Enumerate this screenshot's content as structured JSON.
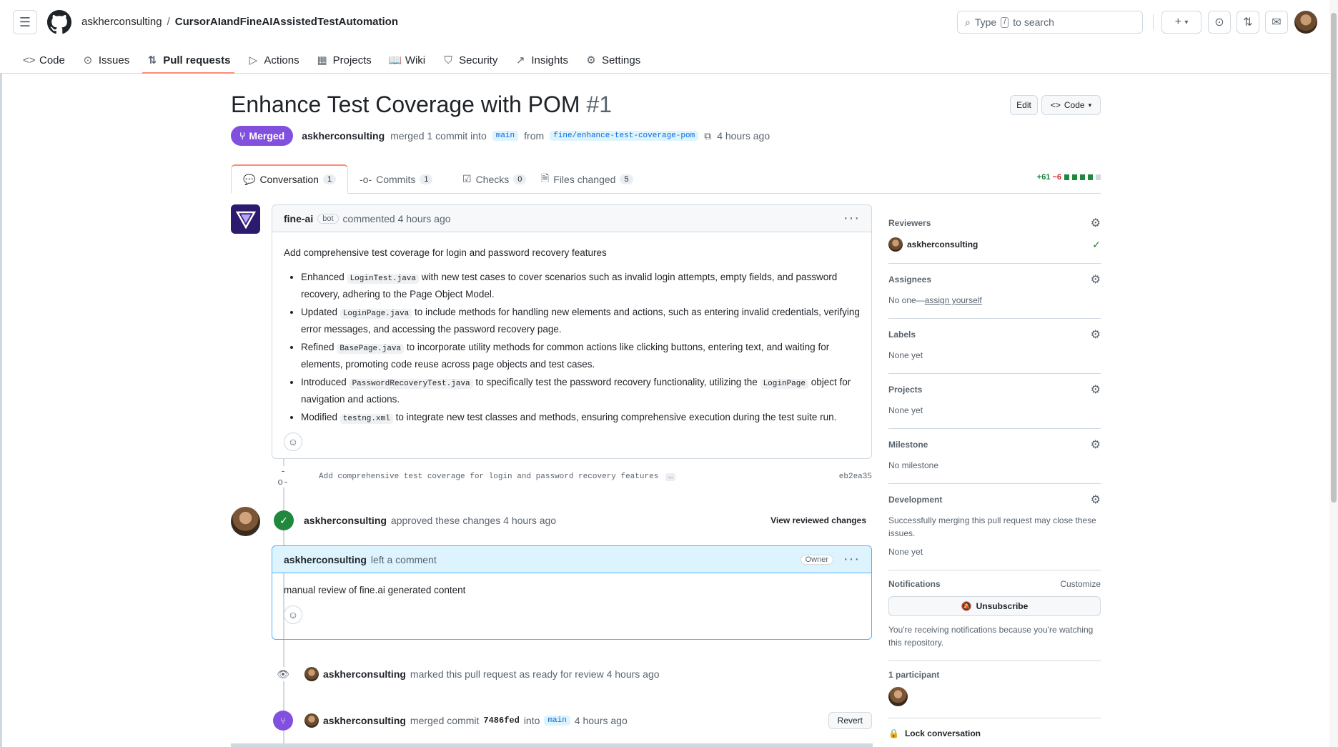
{
  "header": {
    "owner": "askherconsulting",
    "repo": "CursorAIandFineAIAssistedTestAutomation",
    "search_prefix": "Type",
    "search_key": "/",
    "search_suffix": "to search"
  },
  "nav": {
    "code": "Code",
    "issues": "Issues",
    "pull_requests": "Pull requests",
    "actions": "Actions",
    "projects": "Projects",
    "wiki": "Wiki",
    "security": "Security",
    "insights": "Insights",
    "settings": "Settings"
  },
  "pr": {
    "title": "Enhance Test Coverage with POM",
    "number": "#1",
    "edit_label": "Edit",
    "code_label": "Code",
    "state": "Merged",
    "author": "askherconsulting",
    "merged_text": "merged 1 commit into",
    "base_branch": "main",
    "from_text": "from",
    "head_branch": "fine/enhance-test-coverage-pom",
    "time": "4 hours ago"
  },
  "tabs": {
    "conversation": {
      "label": "Conversation",
      "count": "1"
    },
    "commits": {
      "label": "Commits",
      "count": "1"
    },
    "checks": {
      "label": "Checks",
      "count": "0"
    },
    "files": {
      "label": "Files changed",
      "count": "5"
    },
    "additions": "+61",
    "deletions": "−6"
  },
  "comment": {
    "author": "fine-ai",
    "badge": "bot",
    "action": "commented 4 hours ago",
    "intro": "Add comprehensive test coverage for login and password recovery features",
    "items": [
      {
        "pre": "Enhanced",
        "code": "LoginTest.java",
        "post": "with new test cases to cover scenarios such as invalid login attempts, empty fields, and password recovery, adhering to the Page Object Model."
      },
      {
        "pre": "Updated",
        "code": "LoginPage.java",
        "post": "to include methods for handling new elements and actions, such as entering invalid credentials, verifying error messages, and accessing the password recovery page."
      },
      {
        "pre": "Refined",
        "code": "BasePage.java",
        "post": "to incorporate utility methods for common actions like clicking buttons, entering text, and waiting for elements, promoting code reuse across page objects and test cases."
      },
      {
        "pre": "Introduced",
        "code": "PasswordRecoveryTest.java",
        "post": "to specifically test the password recovery functionality, utilizing the",
        "code2": "LoginPage",
        "post2": "object for navigation and actions."
      },
      {
        "pre": "Modified",
        "code": "testng.xml",
        "post": "to integrate new test classes and methods, ensuring comprehensive execution during the test suite run."
      }
    ]
  },
  "commit": {
    "message": "Add comprehensive test coverage for login and password recovery features",
    "ellipsis": "…",
    "sha": "eb2ea35"
  },
  "approval": {
    "author": "askherconsulting",
    "text": "approved these changes 4 hours ago",
    "link": "View reviewed changes"
  },
  "review": {
    "author": "askherconsulting",
    "action": "left a comment",
    "badge": "Owner",
    "body": "manual review of fine.ai generated content"
  },
  "events": {
    "ready_author": "askherconsulting",
    "ready_text": "marked this pull request as ready for review 4 hours ago",
    "merge_author": "askherconsulting",
    "merge_text": "merged commit",
    "merge_sha": "7486fed",
    "merge_into": "into",
    "merge_branch": "main",
    "merge_time": "4 hours ago",
    "revert_label": "Revert"
  },
  "sidebar": {
    "reviewers_title": "Reviewers",
    "reviewer": "askherconsulting",
    "assignees_title": "Assignees",
    "assignees_none": "No one—",
    "assign_link": "assign yourself",
    "labels_title": "Labels",
    "labels_val": "None yet",
    "projects_title": "Projects",
    "projects_val": "None yet",
    "milestone_title": "Milestone",
    "milestone_val": "No milestone",
    "development_title": "Development",
    "development_desc": "Successfully merging this pull request may close these issues.",
    "development_val": "None yet",
    "notifications_title": "Notifications",
    "customize": "Customize",
    "unsubscribe": "Unsubscribe",
    "notif_reason": "You're receiving notifications because you're watching this repository.",
    "participants": "1 participant",
    "lock": "Lock conversation"
  },
  "colors": {
    "merged": "#8250df",
    "approved": "#1f883d",
    "accent_underline": "#fd8c73",
    "link": "#0969da"
  }
}
